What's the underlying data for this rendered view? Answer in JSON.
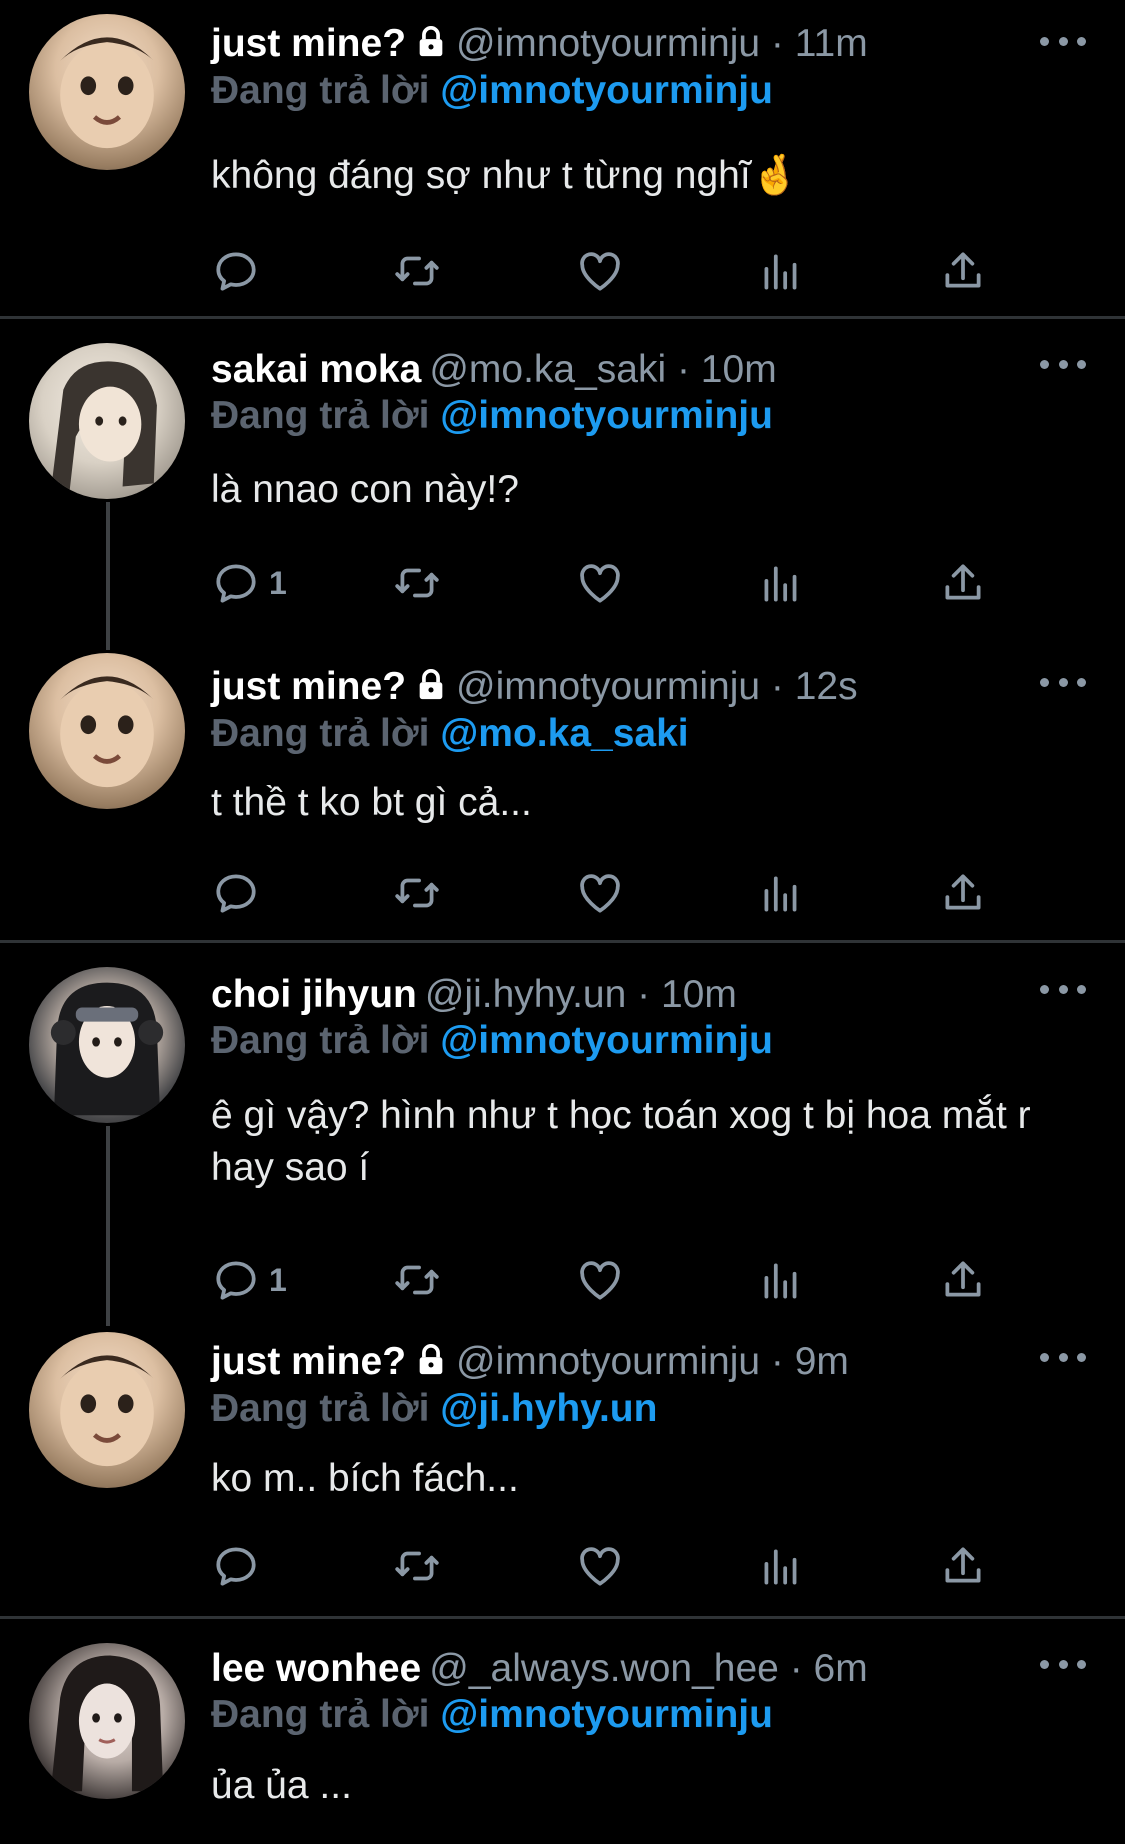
{
  "replying_label": "Đang trả lời",
  "colors": {
    "background": "#000000",
    "link": "#1d9bf0",
    "secondary": "#8b98a5",
    "divider": "#2f3336"
  },
  "tweets": [
    {
      "name": "just mine?",
      "locked": true,
      "handle": "@imnotyourminju · 11m",
      "reply_to": "@imnotyourminju",
      "text": "không đáng sợ như t từng nghĩ🤞",
      "reply_count": ""
    },
    {
      "name": "sakai moka",
      "locked": false,
      "handle": "@mo.ka_saki · 10m",
      "reply_to": "@imnotyourminju",
      "text": "là nnao con này!?",
      "reply_count": "1"
    },
    {
      "name": "just mine?",
      "locked": true,
      "handle": "@imnotyourminju · 12s",
      "reply_to": "@mo.ka_saki",
      "text": "t thề t ko bt gì cả...",
      "reply_count": ""
    },
    {
      "name": "choi jihyun",
      "locked": false,
      "handle": "@ji.hyhy.un · 10m",
      "reply_to": "@imnotyourminju",
      "text": "ê gì vậy? hình như t học toán xog t bị hoa mắt r hay sao í",
      "reply_count": "1"
    },
    {
      "name": "just mine?",
      "locked": true,
      "handle": "@imnotyourminju · 9m",
      "reply_to": "@ji.hyhy.un",
      "text": "ko m.. bích fách...",
      "reply_count": ""
    },
    {
      "name": "lee wonhee",
      "locked": false,
      "handle": "@_always.won_hee · 6m",
      "reply_to": "@imnotyourminju",
      "text": "ủa ủa ...",
      "reply_count": ""
    }
  ]
}
